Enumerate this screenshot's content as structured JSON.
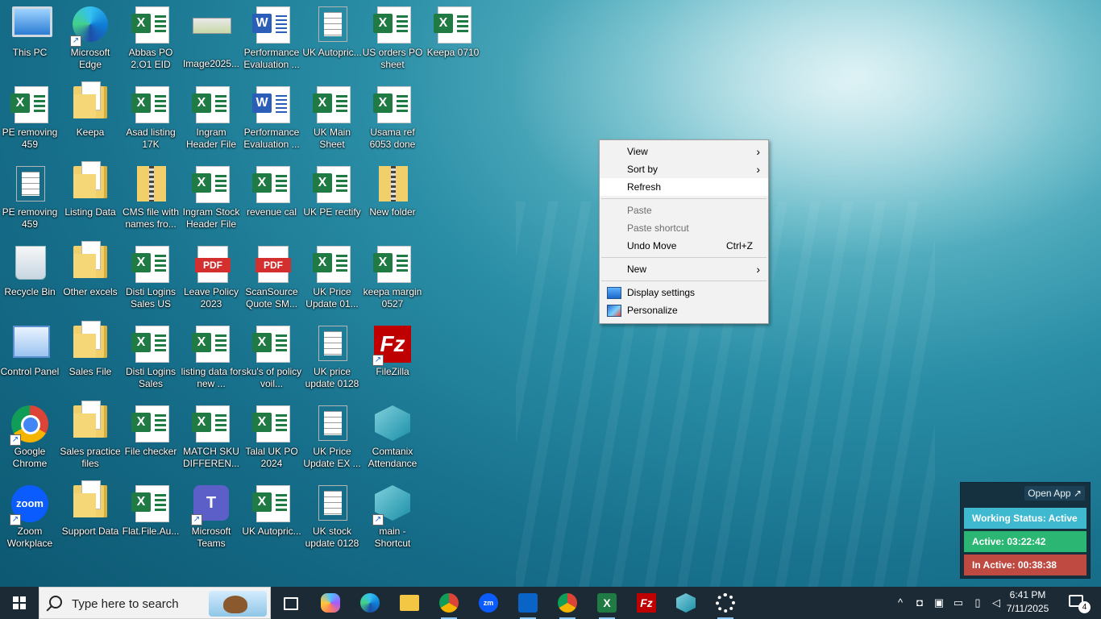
{
  "desktop": {
    "icons": [
      {
        "label": "This PC"
      },
      {
        "label": "Microsoft Edge"
      },
      {
        "label": "Abbas PO 2.O1  EID"
      },
      {
        "label": "Image2025..."
      },
      {
        "label": "Performance Evaluation ..."
      },
      {
        "label": "UK Autopric..."
      },
      {
        "label": "US orders PO sheet"
      },
      {
        "label": "Keepa 0710"
      },
      {
        "label": "PE removing 459"
      },
      {
        "label": "Keepa"
      },
      {
        "label": "Asad listing 17K"
      },
      {
        "label": "Ingram Header File"
      },
      {
        "label": "Performance Evaluation ..."
      },
      {
        "label": "UK Main Sheet"
      },
      {
        "label": "Usama ref 6053 done"
      },
      {
        "label": "PE removing 459"
      },
      {
        "label": "Listing Data"
      },
      {
        "label": "CMS file with names fro..."
      },
      {
        "label": "Ingram Stock Header File"
      },
      {
        "label": "revenue cal"
      },
      {
        "label": "UK PE rectify"
      },
      {
        "label": "New folder"
      },
      {
        "label": "Recycle Bin"
      },
      {
        "label": "Other excels"
      },
      {
        "label": "Disti Logins Sales US"
      },
      {
        "label": "Leave Policy 2023"
      },
      {
        "label": "ScanSource Quote SM..."
      },
      {
        "label": "UK Price Update 01..."
      },
      {
        "label": "keepa margin 0527"
      },
      {
        "label": "Control Panel"
      },
      {
        "label": "Sales File"
      },
      {
        "label": "Disti Logins Sales"
      },
      {
        "label": "listing data for new ..."
      },
      {
        "label": "sku's of policy voil..."
      },
      {
        "label": "UK price update 0128"
      },
      {
        "label": "FileZilla"
      },
      {
        "label": "Google Chrome"
      },
      {
        "label": "Sales practice files"
      },
      {
        "label": "File checker"
      },
      {
        "label": "MATCH SKU DIFFEREN..."
      },
      {
        "label": "Talal UK PO 2024"
      },
      {
        "label": "UK Price Update EX ..."
      },
      {
        "label": "Comtanix Attendance"
      },
      {
        "label": "Zoom Workplace"
      },
      {
        "label": "Support Data"
      },
      {
        "label": "Flat.File.Au..."
      },
      {
        "label": "Microsoft Teams"
      },
      {
        "label": "UK Autopric..."
      },
      {
        "label": "UK stock update 0128"
      },
      {
        "label": "main - Shortcut"
      }
    ]
  },
  "context_menu": {
    "view": "View",
    "sort_by": "Sort by",
    "refresh": "Refresh",
    "paste": "Paste",
    "paste_shortcut": "Paste shortcut",
    "undo_move": "Undo Move",
    "undo_shortcut": "Ctrl+Z",
    "new": "New",
    "display_settings": "Display settings",
    "personalize": "Personalize"
  },
  "widget": {
    "open_app": "Open App ↗",
    "working_status": "Working Status: Active",
    "active": "Active: 03:22:42",
    "inactive": "In Active: 00:38:38"
  },
  "taskbar": {
    "search_placeholder": "Type here to search",
    "time": "6:41 PM",
    "date": "7/11/2025",
    "notification_count": "4",
    "pinned": [
      "Task View",
      "Copilot",
      "Microsoft Edge",
      "File Explorer",
      "Google Chrome",
      "Zoom",
      "Outlook",
      "Chrome Profile",
      "Excel",
      "FileZilla",
      "Comtanix",
      "Settings"
    ]
  },
  "colors": {
    "taskbar_bg": "#1b2a35",
    "widget_working": "#3fb9d0",
    "widget_active": "#2bb673",
    "widget_inactive": "#bf4a42"
  }
}
